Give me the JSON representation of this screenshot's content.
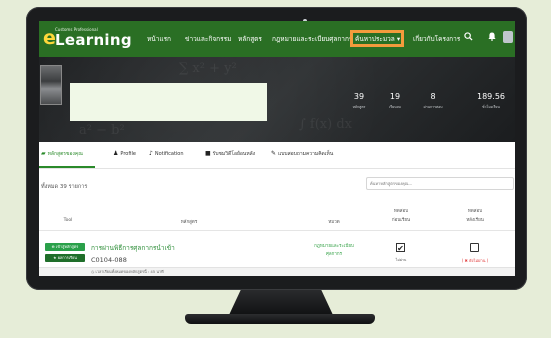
{
  "logo": {
    "small_text": "Customs Professional",
    "mark": "e",
    "text": "Learning"
  },
  "nav": {
    "items": [
      "หน้าแรก",
      "ข่าวและกิจกรรม",
      "หลักสูตร",
      "กฎหมายและระเบียบศุลกากร",
      "ค้นหาประมวล ▾",
      "เกี่ยวกับโครงการ"
    ],
    "active_index": 4,
    "icons": [
      "search-icon",
      "bell-icon",
      "avatar"
    ]
  },
  "stats": [
    {
      "value": "39",
      "label": "หลักสูตร"
    },
    {
      "value": "19",
      "label": "เรียนจบ"
    },
    {
      "value": "8",
      "label": "ผ่านการสอบ"
    },
    {
      "value": "189.56",
      "label": "ชั่วโมงเรียน"
    }
  ],
  "tabs": [
    {
      "label": "หลักสูตรของคุณ",
      "icon": "chart-icon"
    },
    {
      "label": "Profile",
      "icon": "user-icon"
    },
    {
      "label": "Notification",
      "icon": "bell-icon"
    },
    {
      "label": "รับชมวิดีโอย้อนหลัง",
      "icon": "video-icon"
    },
    {
      "label": "แบบสอบถามความคิดเห็น",
      "icon": "pencil-icon"
    }
  ],
  "total_text": "ทั้งหมด 39 รายการ",
  "search": {
    "placeholder": "ค้นหาหลักสูตรของคุณ..."
  },
  "table": {
    "headers": {
      "tool": "Tool",
      "course": "หลักสูตร",
      "category": "หมวด",
      "pretest": "ทดสอบ\nก่อนเรียน",
      "posttest": "ทดสอบ\nหลังเรียน"
    },
    "rows": [
      {
        "badge_primary": "⊕ เข้าสู่หลักสูตร",
        "badge_secondary": "★ ผลการเรียน",
        "name": "การผ่านพิธีการศุลกากรนำเข้า",
        "code": "C0104-088",
        "category": "กฎหมายและระเบียบศุลกากร",
        "pretest_mark": "✔",
        "pretest_label": "ไม่ผ่าน",
        "posttest_label": "( ✖ ยังไม่ผ่าน )"
      }
    ],
    "footer": "◷ เวลาเรียนทั้งหมดของหลักสูตรนี้ : 45 นาที"
  },
  "colors": {
    "nav_bg": "#2a6f24",
    "accent_green": "#2a8a2a",
    "highlight_orange": "#f39b3c",
    "fail_red": "#e03c3c"
  }
}
